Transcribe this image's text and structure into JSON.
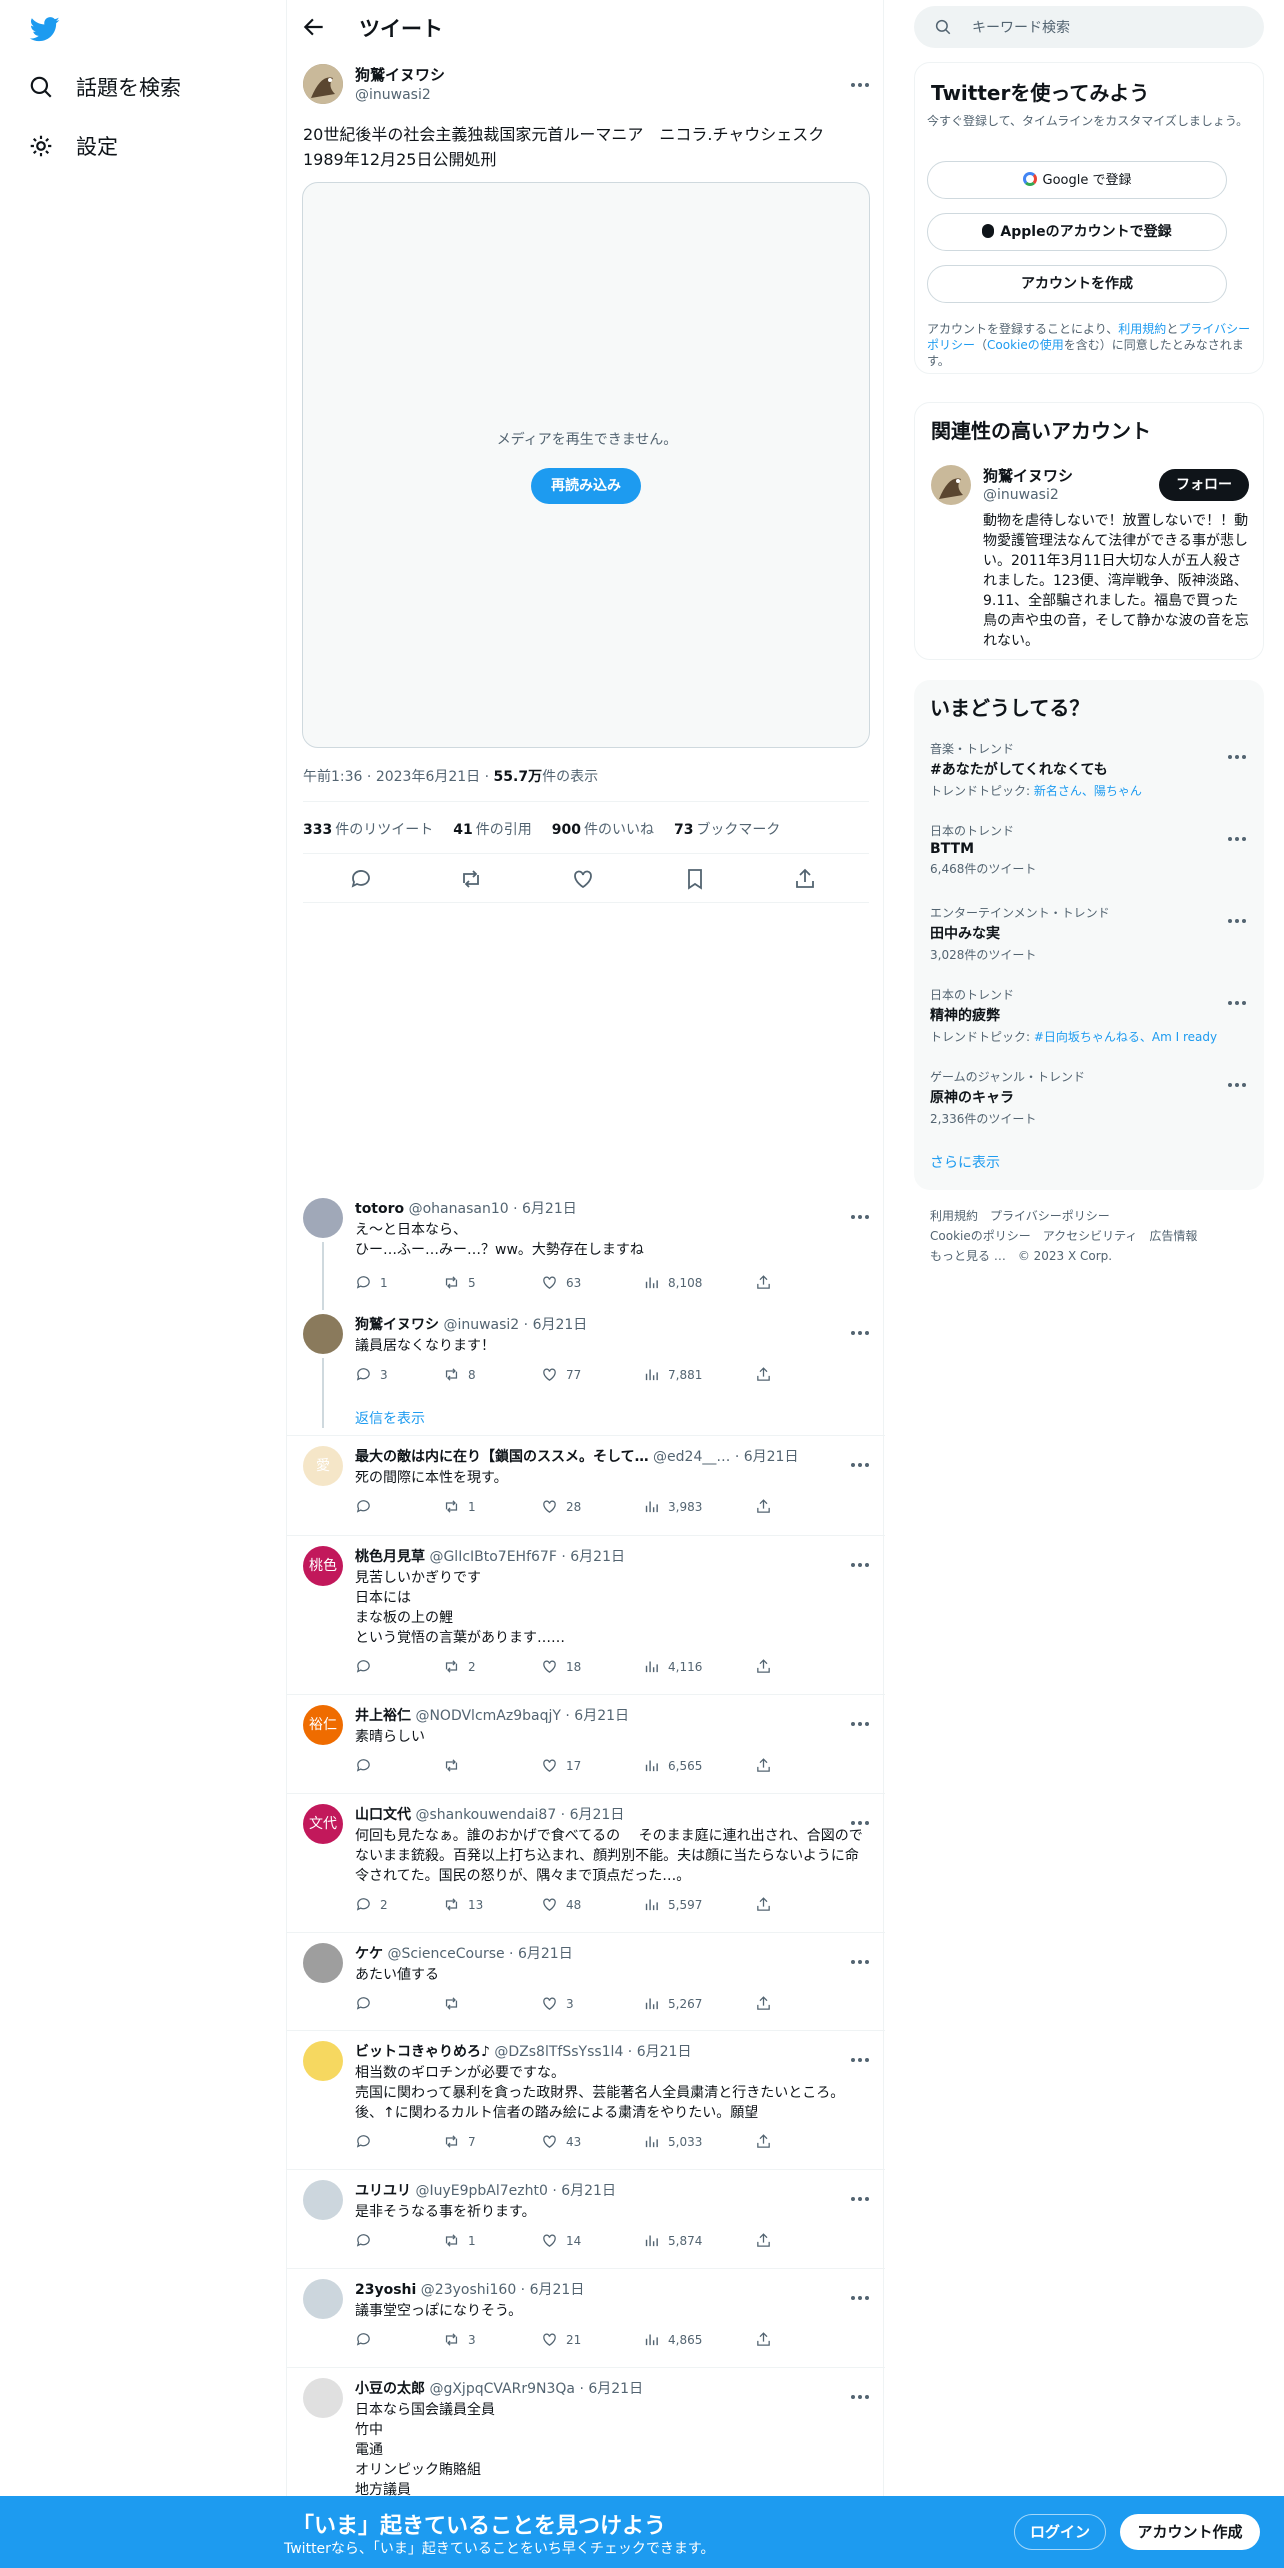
{
  "nav": {
    "explore": "話題を検索",
    "settings": "設定"
  },
  "header": {
    "title": "ツイート"
  },
  "tweet": {
    "author_name": "狗鷲イヌワシ",
    "author_handle": "@inuwasi2",
    "text": "20世紀後半の社会主義独裁国家元首ルーマニア　ニコラ.チャウシェスク\n1989年12月25日公開処刑",
    "media_message": "メディアを再生できません。",
    "reload_label": "再読み込み",
    "time": "午前1:36",
    "date": "2023年6月21日",
    "views_count": "55.7万",
    "views_label": "件の表示",
    "retweets": "333",
    "retweets_label": "件のリツイート",
    "quotes": "41",
    "quotes_label": "件の引用",
    "likes": "900",
    "likes_label": "件のいいね",
    "bookmarks": "73",
    "bookmarks_label": "ブックマーク"
  },
  "replies": [
    {
      "name": "totoro",
      "handle": "@ohanasan10",
      "date": "6月21日",
      "text": "え〜と日本なら、\nひー…ふー…みー…？ww。大勢存在しますね",
      "replies": "1",
      "retweets": "5",
      "likes": "63",
      "views": "8,108",
      "avatar_text": "",
      "avatar_color": "#a0a8b8"
    },
    {
      "name": "狗鷲イヌワシ",
      "handle": "@inuwasi2",
      "date": "6月21日",
      "text": "議員居なくなります！",
      "replies": "3",
      "retweets": "8",
      "likes": "77",
      "views": "7,881",
      "avatar_text": "",
      "avatar_color": "#8a7a5c"
    },
    {
      "name": "最大の敵は内に在り【鎖国のススメ。そして…",
      "handle": "@ed24__…",
      "date": "6月21日",
      "text": "死の間際に本性を現す。",
      "replies": "",
      "retweets": "1",
      "likes": "28",
      "views": "3,983",
      "avatar_text": "愛",
      "avatar_color": "#f5e6c8"
    },
    {
      "name": "桃色月見草",
      "handle": "@GlIcIBto7EHf67F",
      "date": "6月21日",
      "text": "見苦しいかぎりです\n日本には\nまな板の上の鯉\nという覚悟の言葉があります……",
      "replies": "",
      "retweets": "2",
      "likes": "18",
      "views": "4,116",
      "avatar_text": "桃色",
      "avatar_color": "#c2185b"
    },
    {
      "name": "井上裕仁",
      "handle": "@NODVlcmAz9baqjY",
      "date": "6月21日",
      "text": "素晴らしい",
      "replies": "",
      "retweets": "",
      "likes": "17",
      "views": "6,565",
      "avatar_text": "裕仁",
      "avatar_color": "#ef6c00"
    },
    {
      "name": "山口文代",
      "handle": "@shankouwendai87",
      "date": "6月21日",
      "text": "何回も見たなぁ。誰のおかげで食べてるの　 そのまま庭に連れ出され、合図のでないまま銃殺。百発以上打ち込まれ、顔判別不能。夫は顔に当たらないように命令されてた。国民の怒りが、隅々まで頂点だった…。",
      "replies": "2",
      "retweets": "13",
      "likes": "48",
      "views": "5,597",
      "avatar_text": "文代",
      "avatar_color": "#c2185b"
    },
    {
      "name": "ケケ",
      "handle": "@ScienceCourse",
      "date": "6月21日",
      "text": "あたい値する",
      "replies": "",
      "retweets": "",
      "likes": "3",
      "views": "5,267",
      "avatar_text": "",
      "avatar_color": "#9e9e9e"
    },
    {
      "name": "ビットコきゃりめろ♪",
      "handle": "@DZs8lTfSsYss1l4",
      "date": "6月21日",
      "text": "相当数のギロチンが必要ですな。\n売国に関わって暴利を貪った政財界、芸能著名人全員粛清と行きたいところ。後、↑に関わるカルト信者の踏み絵による粛清をやりたい。願望",
      "replies": "",
      "retweets": "7",
      "likes": "43",
      "views": "5,033",
      "avatar_text": "",
      "avatar_color": "#f6d860"
    },
    {
      "name": "ユリユリ",
      "handle": "@IuyE9pbAl7ezht0",
      "date": "6月21日",
      "text": "是非そうなる事を祈ります。",
      "replies": "",
      "retweets": "1",
      "likes": "14",
      "views": "5,874",
      "avatar_text": "",
      "avatar_color": "#ccd6dd"
    },
    {
      "name": "23yoshi",
      "handle": "@23yoshi160",
      "date": "6月21日",
      "text": "議事堂空っぽになりそう。",
      "replies": "",
      "retweets": "3",
      "likes": "21",
      "views": "4,865",
      "avatar_text": "",
      "avatar_color": "#ccd6dd"
    },
    {
      "name": "小豆の太郎",
      "handle": "@gXjpqCVARr9N3Qa",
      "date": "6月21日",
      "text": "日本なら国会議員全員\n竹中\n電通\nオリンピック賄賂組\n地方議員",
      "replies": "",
      "retweets": "",
      "likes": "",
      "views": "",
      "avatar_text": "",
      "avatar_color": "#e0e0e0"
    }
  ],
  "show_replies": "返信を表示",
  "right": {
    "search_placeholder": "キーワード検索",
    "signup_title": "Twitterを使ってみよう",
    "signup_sub": "今すぐ登録して、タイムラインをカスタマイズしましょう。",
    "google_label": "Google で登録",
    "apple_label": "Appleのアカウントで登録",
    "create_label": "アカウントを作成",
    "terms_1": "アカウントを登録することにより、",
    "terms_link1": "利用規約",
    "terms_2": "と",
    "terms_link2": "プライバシーポリシー",
    "terms_3": "（",
    "terms_link3": "Cookieの使用",
    "terms_4": "を含む）に同意したとみなされます。",
    "related_title": "関連性の高いアカウント",
    "related_name": "狗鷲イヌワシ",
    "related_handle": "@inuwasi2",
    "follow_label": "フォロー",
    "related_bio": "動物を虐待しないで！放置しないで！！動物愛護管理法なんて法律ができる事が悲しい。2011年3月11日大切な人が五人殺されました。123便、湾岸戦争、阪神淡路、9.11、全部騙されました。福島で買った鳥の声や虫の音，そして静かな波の音を忘れない。",
    "trends_title": "いまどうしてる？",
    "trends": [
      {
        "cat": "音楽・トレンド",
        "title": "#あなたがしてくれなくても",
        "sub_prefix": "トレンドトピック: ",
        "sub_link": "新名さん、陽ちゃん",
        "sub": ""
      },
      {
        "cat": "日本のトレンド",
        "title": "BTTM",
        "sub_prefix": "",
        "sub_link": "",
        "sub": "6,468件のツイート"
      },
      {
        "cat": "エンターテインメント・トレンド",
        "title": "田中みな実",
        "sub_prefix": "",
        "sub_link": "",
        "sub": "3,028件のツイート"
      },
      {
        "cat": "日本のトレンド",
        "title": "精神的疲弊",
        "sub_prefix": "トレンドトピック: ",
        "sub_link": "#日向坂ちゃんねる、Am I ready",
        "sub": ""
      },
      {
        "cat": "ゲームのジャンル・トレンド",
        "title": "原神のキャラ",
        "sub_prefix": "",
        "sub_link": "",
        "sub": "2,336件のツイート"
      }
    ],
    "show_more": "さらに表示",
    "footer_1": "利用規約　プライバシーポリシー",
    "footer_2": "Cookieのポリシー　アクセシビリティ　広告情報",
    "footer_3": "もっと見る …　© 2023 X Corp."
  },
  "bottom": {
    "title": "「いま」起きていることを見つけよう",
    "sub": "Twitterなら、「いま」起きていることをいち早くチェックできます。",
    "login": "ログイン",
    "signup": "アカウント作成"
  },
  "colors": {
    "accent": "#1d9bf0",
    "text": "#0f1419",
    "muted": "#536471"
  }
}
